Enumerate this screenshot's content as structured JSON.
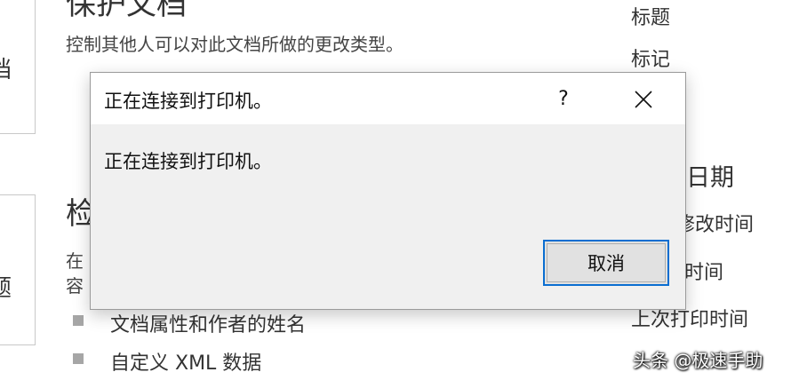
{
  "background": {
    "protect_title": "保护文档",
    "protect_desc": "控制其他人可以对此文档所做的更改类型。",
    "inspect_title": "检",
    "inspect_desc_line1": "在",
    "inspect_desc_line2": "容",
    "bullets": [
      "文档属性和作者的姓名",
      "自定义 XML 数据"
    ],
    "left_card_top_glyph": "档",
    "left_card_bottom_glyph": "题",
    "right_panel": {
      "items_top": [
        "标题",
        "标记"
      ],
      "dates_heading": "日期",
      "date_items": [
        "修改时间",
        "时间",
        "上次打印时间"
      ]
    }
  },
  "dialog": {
    "title": "正在连接到打印机。",
    "help_label": "?",
    "close_icon": "close-icon",
    "message": "正在连接到打印机。",
    "cancel_label": "取消",
    "accent_color": "#0a6ed1"
  },
  "watermark": "头条 @极速手助"
}
